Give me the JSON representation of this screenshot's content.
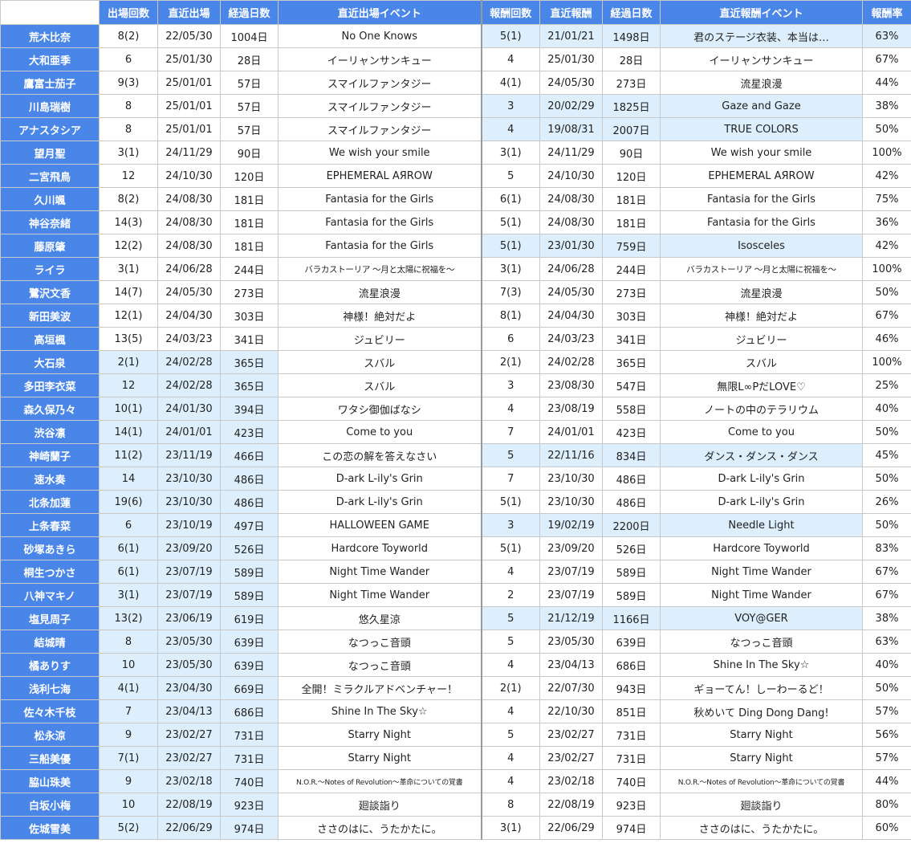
{
  "columns": {
    "appearances": "出場回数",
    "recent_appearance": "直近出場",
    "elapsed_days": "経過日数",
    "recent_appearance_event": "直近出場イベント",
    "rewards": "報酬回数",
    "recent_reward": "直近報酬",
    "reward_elapsed_days": "経過日数",
    "recent_reward_event": "直近報酬イベント",
    "reward_rate": "報酬率"
  },
  "rows": [
    {
      "name": "荒木比奈",
      "app": "8(2)",
      "app_date": "22/05/30",
      "app_days": "1004日",
      "app_event": "No One Knows",
      "rew": "5(1)",
      "rew_date": "21/01/21",
      "rew_days": "1498日",
      "rew_event": "君のステージ衣装、本当は…",
      "rate": "63%"
    },
    {
      "name": "大和亜季",
      "app": "6",
      "app_date": "25/01/30",
      "app_days": "28日",
      "app_event": "イーリャンサンキュー",
      "rew": "4",
      "rew_date": "25/01/30",
      "rew_days": "28日",
      "rew_event": "イーリャンサンキュー",
      "rate": "67%"
    },
    {
      "name": "鷹富士茄子",
      "app": "9(3)",
      "app_date": "25/01/01",
      "app_days": "57日",
      "app_event": "スマイルファンタジー",
      "rew": "4(1)",
      "rew_date": "24/05/30",
      "rew_days": "273日",
      "rew_event": "流星浪漫",
      "rate": "44%"
    },
    {
      "name": "川島瑞樹",
      "app": "8",
      "app_date": "25/01/01",
      "app_days": "57日",
      "app_event": "スマイルファンタジー",
      "rew": "3",
      "rew_date": "20/02/29",
      "rew_days": "1825日",
      "rew_event": "Gaze and Gaze",
      "rate": "38%"
    },
    {
      "name": "アナスタシア",
      "app": "8",
      "app_date": "25/01/01",
      "app_days": "57日",
      "app_event": "スマイルファンタジー",
      "rew": "4",
      "rew_date": "19/08/31",
      "rew_days": "2007日",
      "rew_event": "TRUE COLORS",
      "rate": "50%"
    },
    {
      "name": "望月聖",
      "app": "3(1)",
      "app_date": "24/11/29",
      "app_days": "90日",
      "app_event": "We wish your smile",
      "rew": "3(1)",
      "rew_date": "24/11/29",
      "rew_days": "90日",
      "rew_event": "We wish your smile",
      "rate": "100%"
    },
    {
      "name": "二宮飛鳥",
      "app": "12",
      "app_date": "24/10/30",
      "app_days": "120日",
      "app_event": "EPHEMERAL AЯROW",
      "rew": "5",
      "rew_date": "24/10/30",
      "rew_days": "120日",
      "rew_event": "EPHEMERAL AЯROW",
      "rate": "42%"
    },
    {
      "name": "久川颯",
      "app": "8(2)",
      "app_date": "24/08/30",
      "app_days": "181日",
      "app_event": "Fantasia for the Girls",
      "rew": "6(1)",
      "rew_date": "24/08/30",
      "rew_days": "181日",
      "rew_event": "Fantasia for the Girls",
      "rate": "75%"
    },
    {
      "name": "神谷奈緒",
      "app": "14(3)",
      "app_date": "24/08/30",
      "app_days": "181日",
      "app_event": "Fantasia for the Girls",
      "rew": "5(1)",
      "rew_date": "24/08/30",
      "rew_days": "181日",
      "rew_event": "Fantasia for the Girls",
      "rate": "36%"
    },
    {
      "name": "藤原肇",
      "app": "12(2)",
      "app_date": "24/08/30",
      "app_days": "181日",
      "app_event": "Fantasia for the Girls",
      "rew": "5(1)",
      "rew_date": "23/01/30",
      "rew_days": "759日",
      "rew_event": "Isosceles",
      "rate": "42%"
    },
    {
      "name": "ライラ",
      "app": "3(1)",
      "app_date": "24/06/28",
      "app_days": "244日",
      "app_event": "バラカストーリア 〜月と太陽に祝福を〜",
      "rew": "3(1)",
      "rew_date": "24/06/28",
      "rew_days": "244日",
      "rew_event": "バラカストーリア 〜月と太陽に祝福を〜",
      "rate": "100%"
    },
    {
      "name": "鷺沢文香",
      "app": "14(7)",
      "app_date": "24/05/30",
      "app_days": "273日",
      "app_event": "流星浪漫",
      "rew": "7(3)",
      "rew_date": "24/05/30",
      "rew_days": "273日",
      "rew_event": "流星浪漫",
      "rate": "50%"
    },
    {
      "name": "新田美波",
      "app": "12(1)",
      "app_date": "24/04/30",
      "app_days": "303日",
      "app_event": "神様！絶対だよ",
      "rew": "8(1)",
      "rew_date": "24/04/30",
      "rew_days": "303日",
      "rew_event": "神様！絶対だよ",
      "rate": "67%"
    },
    {
      "name": "高垣楓",
      "app": "13(5)",
      "app_date": "24/03/23",
      "app_days": "341日",
      "app_event": "ジュビリー",
      "rew": "6",
      "rew_date": "24/03/23",
      "rew_days": "341日",
      "rew_event": "ジュビリー",
      "rate": "46%"
    },
    {
      "name": "大石泉",
      "app": "2(1)",
      "app_date": "24/02/28",
      "app_days": "365日",
      "app_event": "スバル",
      "rew": "2(1)",
      "rew_date": "24/02/28",
      "rew_days": "365日",
      "rew_event": "スバル",
      "rate": "100%"
    },
    {
      "name": "多田李衣菜",
      "app": "12",
      "app_date": "24/02/28",
      "app_days": "365日",
      "app_event": "スバル",
      "rew": "3",
      "rew_date": "23/08/30",
      "rew_days": "547日",
      "rew_event": "無限L∞PだLOVE♡",
      "rate": "25%"
    },
    {
      "name": "森久保乃々",
      "app": "10(1)",
      "app_date": "24/01/30",
      "app_days": "394日",
      "app_event": "ワタシ御伽ばなシ",
      "rew": "4",
      "rew_date": "23/08/19",
      "rew_days": "558日",
      "rew_event": "ノートの中のテラリウム",
      "rate": "40%"
    },
    {
      "name": "渋谷凛",
      "app": "14(1)",
      "app_date": "24/01/01",
      "app_days": "423日",
      "app_event": "Come to you",
      "rew": "7",
      "rew_date": "24/01/01",
      "rew_days": "423日",
      "rew_event": "Come to you",
      "rate": "50%"
    },
    {
      "name": "神崎蘭子",
      "app": "11(2)",
      "app_date": "23/11/19",
      "app_days": "466日",
      "app_event": "この恋の解を答えなさい",
      "rew": "5",
      "rew_date": "22/11/16",
      "rew_days": "834日",
      "rew_event": "ダンス・ダンス・ダンス",
      "rate": "45%"
    },
    {
      "name": "速水奏",
      "app": "14",
      "app_date": "23/10/30",
      "app_days": "486日",
      "app_event": "D-ark L-ily's Grin",
      "rew": "7",
      "rew_date": "23/10/30",
      "rew_days": "486日",
      "rew_event": "D-ark L-ily's Grin",
      "rate": "50%"
    },
    {
      "name": "北条加蓮",
      "app": "19(6)",
      "app_date": "23/10/30",
      "app_days": "486日",
      "app_event": "D-ark L-ily's Grin",
      "rew": "5(1)",
      "rew_date": "23/10/30",
      "rew_days": "486日",
      "rew_event": "D-ark L-ily's Grin",
      "rate": "26%"
    },
    {
      "name": "上条春菜",
      "app": "6",
      "app_date": "23/10/19",
      "app_days": "497日",
      "app_event": "HALLOWEEN GAME",
      "rew": "3",
      "rew_date": "19/02/19",
      "rew_days": "2200日",
      "rew_event": "Needle Light",
      "rate": "50%"
    },
    {
      "name": "砂塚あきら",
      "app": "6(1)",
      "app_date": "23/09/20",
      "app_days": "526日",
      "app_event": "Hardcore Toyworld",
      "rew": "5(1)",
      "rew_date": "23/09/20",
      "rew_days": "526日",
      "rew_event": "Hardcore Toyworld",
      "rate": "83%"
    },
    {
      "name": "桐生つかさ",
      "app": "6(1)",
      "app_date": "23/07/19",
      "app_days": "589日",
      "app_event": "Night Time Wander",
      "rew": "4",
      "rew_date": "23/07/19",
      "rew_days": "589日",
      "rew_event": "Night Time Wander",
      "rate": "67%"
    },
    {
      "name": "八神マキノ",
      "app": "3(1)",
      "app_date": "23/07/19",
      "app_days": "589日",
      "app_event": "Night Time Wander",
      "rew": "2",
      "rew_date": "23/07/19",
      "rew_days": "589日",
      "rew_event": "Night Time Wander",
      "rate": "67%"
    },
    {
      "name": "塩見周子",
      "app": "13(2)",
      "app_date": "23/06/19",
      "app_days": "619日",
      "app_event": "悠久星涼",
      "rew": "5",
      "rew_date": "21/12/19",
      "rew_days": "1166日",
      "rew_event": "VOY@GER",
      "rate": "38%"
    },
    {
      "name": "結城晴",
      "app": "8",
      "app_date": "23/05/30",
      "app_days": "639日",
      "app_event": "なつっこ音頭",
      "rew": "5",
      "rew_date": "23/05/30",
      "rew_days": "639日",
      "rew_event": "なつっこ音頭",
      "rate": "63%"
    },
    {
      "name": "橘ありす",
      "app": "10",
      "app_date": "23/05/30",
      "app_days": "639日",
      "app_event": "なつっこ音頭",
      "rew": "4",
      "rew_date": "23/04/13",
      "rew_days": "686日",
      "rew_event": "Shine In The Sky☆",
      "rate": "40%"
    },
    {
      "name": "浅利七海",
      "app": "4(1)",
      "app_date": "23/04/30",
      "app_days": "669日",
      "app_event": "全開！ミラクルアドベンチャー！",
      "rew": "2(1)",
      "rew_date": "22/07/30",
      "rew_days": "943日",
      "rew_event": "ギョーてん！しーわーるど！",
      "rate": "50%"
    },
    {
      "name": "佐々木千枝",
      "app": "7",
      "app_date": "23/04/13",
      "app_days": "686日",
      "app_event": "Shine In The Sky☆",
      "rew": "4",
      "rew_date": "22/10/30",
      "rew_days": "851日",
      "rew_event": "秋めいて Ding Dong Dang!",
      "rate": "57%"
    },
    {
      "name": "松永涼",
      "app": "9",
      "app_date": "23/02/27",
      "app_days": "731日",
      "app_event": "Starry Night",
      "rew": "5",
      "rew_date": "23/02/27",
      "rew_days": "731日",
      "rew_event": "Starry Night",
      "rate": "56%"
    },
    {
      "name": "三船美優",
      "app": "7(1)",
      "app_date": "23/02/27",
      "app_days": "731日",
      "app_event": "Starry Night",
      "rew": "4",
      "rew_date": "23/02/27",
      "rew_days": "731日",
      "rew_event": "Starry Night",
      "rate": "57%"
    },
    {
      "name": "脇山珠美",
      "app": "9",
      "app_date": "23/02/18",
      "app_days": "740日",
      "app_event": "N.O.R.〜Notes of Revolution〜革命についての覚書",
      "rew": "4",
      "rew_date": "23/02/18",
      "rew_days": "740日",
      "rew_event": "N.O.R.〜Notes of Revolution〜革命についての覚書",
      "rate": "44%"
    },
    {
      "name": "白坂小梅",
      "app": "10",
      "app_date": "22/08/19",
      "app_days": "923日",
      "app_event": "廻談詣り",
      "rew": "8",
      "rew_date": "22/08/19",
      "rew_days": "923日",
      "rew_event": "廻談詣り",
      "rate": "80%"
    },
    {
      "name": "佐城雪美",
      "app": "5(2)",
      "app_date": "22/06/29",
      "app_days": "974日",
      "app_event": "ささのはに、うたかたに。",
      "rew": "3(1)",
      "rew_date": "22/06/29",
      "rew_days": "974日",
      "rew_event": "ささのはに、うたかたに。",
      "rate": "60%"
    }
  ],
  "highlight": [
    [
      1,
      0,
      0,
      0,
      0,
      1,
      1,
      1,
      1,
      1
    ],
    [
      0,
      0,
      0,
      0,
      0,
      0,
      0,
      0,
      0,
      0
    ],
    [
      0,
      0,
      0,
      0,
      0,
      0,
      0,
      0,
      0,
      0
    ],
    [
      0,
      0,
      0,
      0,
      0,
      1,
      1,
      1,
      1,
      0
    ],
    [
      0,
      0,
      0,
      0,
      0,
      1,
      1,
      1,
      1,
      0
    ],
    [
      0,
      0,
      0,
      0,
      0,
      0,
      0,
      0,
      0,
      0
    ],
    [
      0,
      0,
      0,
      0,
      0,
      0,
      0,
      0,
      0,
      0
    ],
    [
      0,
      0,
      0,
      0,
      0,
      0,
      0,
      0,
      0,
      0
    ],
    [
      0,
      0,
      0,
      0,
      0,
      0,
      0,
      0,
      0,
      0
    ],
    [
      0,
      0,
      0,
      0,
      0,
      1,
      1,
      1,
      1,
      0
    ],
    [
      0,
      0,
      0,
      0,
      0,
      0,
      0,
      0,
      0,
      0
    ],
    [
      0,
      0,
      0,
      0,
      0,
      0,
      0,
      0,
      0,
      0
    ],
    [
      0,
      0,
      0,
      0,
      0,
      0,
      0,
      0,
      0,
      0
    ],
    [
      0,
      0,
      0,
      0,
      0,
      0,
      0,
      0,
      0,
      0
    ],
    [
      1,
      1,
      1,
      1,
      0,
      0,
      0,
      0,
      0,
      0
    ],
    [
      1,
      1,
      1,
      1,
      0,
      0,
      0,
      0,
      0,
      0
    ],
    [
      1,
      1,
      1,
      1,
      0,
      0,
      0,
      0,
      0,
      0
    ],
    [
      1,
      1,
      1,
      1,
      0,
      0,
      0,
      0,
      0,
      0
    ],
    [
      1,
      1,
      1,
      1,
      0,
      1,
      1,
      1,
      1,
      0
    ],
    [
      1,
      1,
      1,
      1,
      0,
      0,
      0,
      0,
      0,
      0
    ],
    [
      1,
      1,
      1,
      1,
      0,
      0,
      0,
      0,
      0,
      0
    ],
    [
      1,
      1,
      1,
      1,
      0,
      1,
      1,
      1,
      1,
      0
    ],
    [
      1,
      1,
      1,
      1,
      0,
      0,
      0,
      0,
      0,
      0
    ],
    [
      1,
      1,
      1,
      1,
      0,
      0,
      0,
      0,
      0,
      0
    ],
    [
      1,
      1,
      1,
      1,
      0,
      0,
      0,
      0,
      0,
      0
    ],
    [
      1,
      1,
      1,
      1,
      0,
      1,
      1,
      1,
      1,
      0
    ],
    [
      1,
      1,
      1,
      1,
      0,
      0,
      0,
      0,
      0,
      0
    ],
    [
      1,
      1,
      1,
      1,
      0,
      0,
      0,
      0,
      0,
      0
    ],
    [
      1,
      1,
      1,
      1,
      0,
      0,
      0,
      0,
      0,
      0
    ],
    [
      1,
      1,
      1,
      1,
      0,
      0,
      0,
      0,
      0,
      0
    ],
    [
      1,
      1,
      1,
      1,
      0,
      0,
      0,
      0,
      0,
      0
    ],
    [
      1,
      1,
      1,
      1,
      0,
      0,
      0,
      0,
      0,
      0
    ],
    [
      1,
      1,
      1,
      1,
      0,
      0,
      0,
      0,
      0,
      0
    ],
    [
      1,
      1,
      1,
      1,
      0,
      0,
      0,
      0,
      0,
      0
    ],
    [
      1,
      1,
      1,
      1,
      0,
      0,
      0,
      0,
      0,
      0
    ]
  ],
  "colors": {
    "header_blue": "#4a86e8",
    "highlight_blue": "#ddeefc",
    "grid": "#c9c9c9"
  }
}
